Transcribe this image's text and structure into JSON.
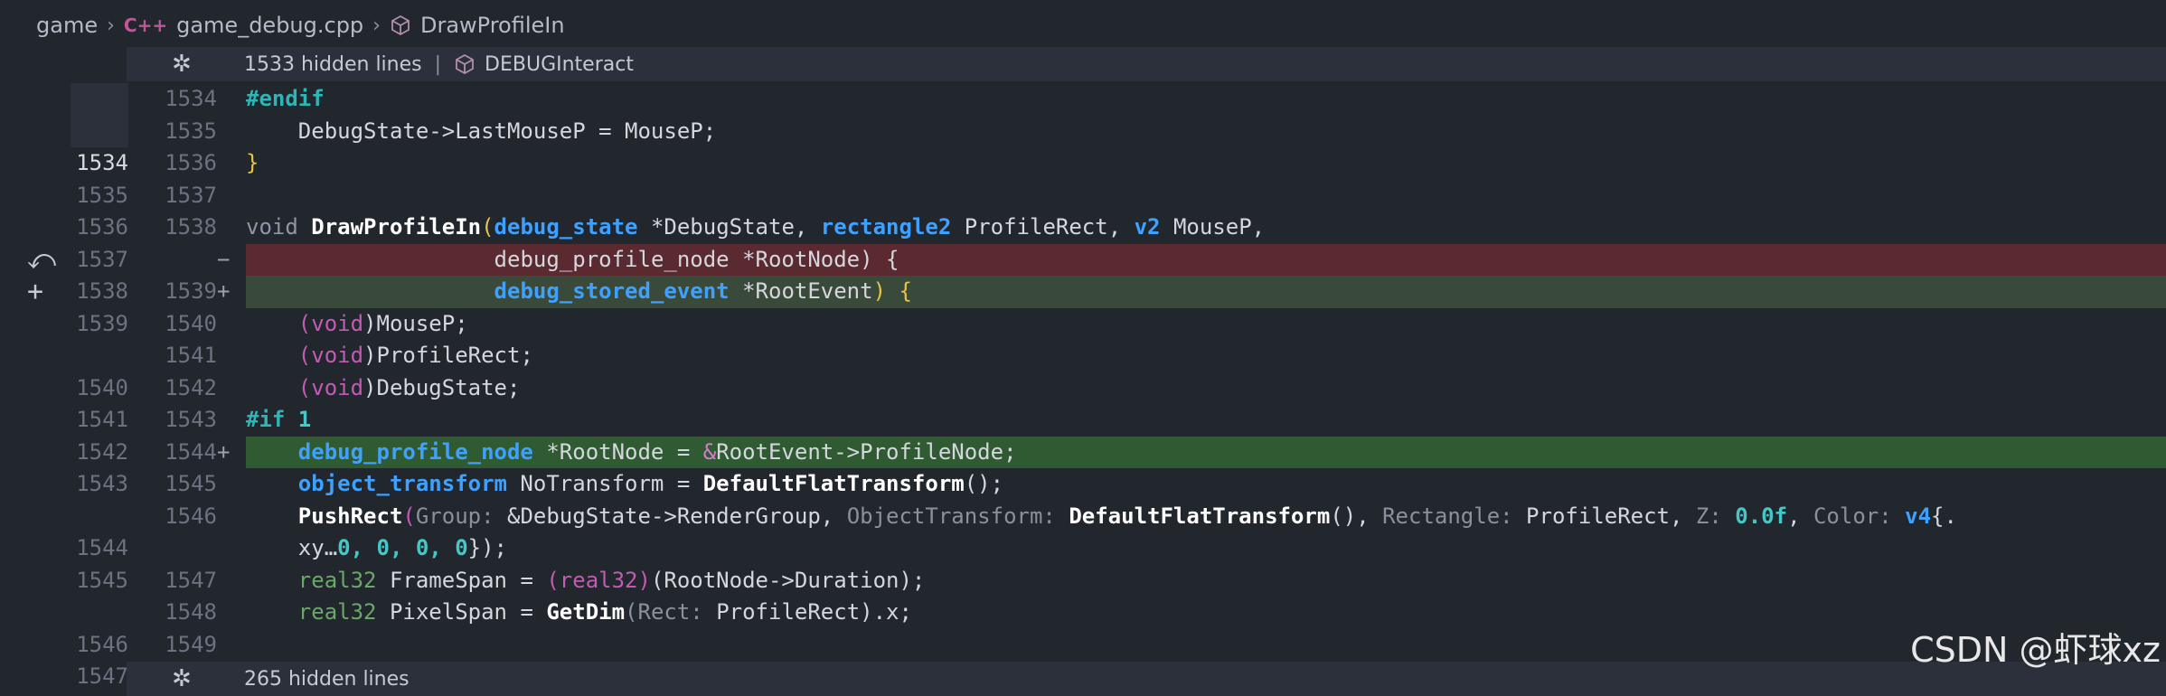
{
  "breadcrumb": {
    "folder": "game",
    "file": "game_debug.cpp",
    "file_icon": "C++",
    "symbol": "DrawProfileIn"
  },
  "fold_top": {
    "hidden": "1533 hidden lines",
    "symbol": "DEBUGInteract"
  },
  "fold_bottom": {
    "hidden": "265 hidden lines"
  },
  "gutter_icons": {
    "revert": "⤺",
    "add": "+"
  },
  "rows": [
    {
      "old": "",
      "new": "1534",
      "mark": ""
    },
    {
      "old": "",
      "new": "1535",
      "mark": ""
    },
    {
      "old": "1534",
      "new": "1536",
      "mark": ""
    },
    {
      "old": "1535",
      "new": "1537",
      "mark": ""
    },
    {
      "old": "1536",
      "new": "1538",
      "mark": ""
    },
    {
      "old": "1537",
      "new": "",
      "mark": "−"
    },
    {
      "old": "1538",
      "new": "1539",
      "mark": "+"
    },
    {
      "old": "1539",
      "new": "1540",
      "mark": ""
    },
    {
      "old": "",
      "new": "1541",
      "mark": ""
    },
    {
      "old": "1540",
      "new": "1542",
      "mark": ""
    },
    {
      "old": "1541",
      "new": "1543",
      "mark": ""
    },
    {
      "old": "1542",
      "new": "1544",
      "mark": "+"
    },
    {
      "old": "1543",
      "new": "1545",
      "mark": ""
    },
    {
      "old": "",
      "new": "1546",
      "mark": ""
    },
    {
      "old": "1544",
      "new": "",
      "mark": ""
    },
    {
      "old": "1545",
      "new": "1547",
      "mark": ""
    },
    {
      "old": "",
      "new": "1548",
      "mark": ""
    },
    {
      "old": "1546",
      "new": "1549",
      "mark": ""
    },
    {
      "old": "1547",
      "new": "",
      "mark": ""
    }
  ],
  "code": {
    "l0": "#endif",
    "l1a": "DebugState->LastMouseP = MouseP;",
    "l2": "}",
    "l4_void": "void ",
    "l4_fn": "DrawProfileIn",
    "l4_p": "(",
    "l4_t1": "debug_state",
    "l4_a1": " *DebugState, ",
    "l4_t2": "rectangle2",
    "l4_a2": " ProfileRect, ",
    "l4_t3": "v2",
    "l4_a3": " MouseP,",
    "l5": "debug_profile_node *RootNode) {",
    "l6_t": "debug_stored_event",
    "l6_a": " *RootEvent",
    "l6_p": ")",
    "l6_b": " {",
    "l7_a": "(",
    "l7_v": "void",
    "l7_b": ")MouseP;",
    "l8_b": ")ProfileRect;",
    "l9_b": ")DebugState;",
    "l10_a": "#if ",
    "l10_n": "1",
    "l11_t": "debug_profile_node",
    "l11_a": " *RootNode = ",
    "l11_op": "&",
    "l11_b": "RootEvent->ProfileNode;",
    "l12_t": "object_transform",
    "l12_a": " NoTransform = ",
    "l12_f": "DefaultFlatTransform",
    "l12_b": "();",
    "l13_f": "PushRect",
    "l13_a": "(",
    "l13_h1": "Group:",
    "l13_v1": " &DebugState->RenderGroup, ",
    "l13_h2": "ObjectTransform:",
    "l13_f2": " DefaultFlatTransform",
    "l13_v2": "(), ",
    "l13_h3": "Rectangle:",
    "l13_v3": " ProfileRect, ",
    "l13_h4": "Z:",
    "l13_n1": " 0.0f",
    "l13_v4": ", ",
    "l13_h5": "Color:",
    "l13_t5": " v4",
    "l13_v5": "{.",
    "l14_a": "xy…",
    "l14_n": "0, 0, 0, 0",
    "l14_b": "});",
    "l15_t": "real32",
    "l15_a": " FrameSpan = ",
    "l15_c": "(real32)",
    "l15_b": "(RootNode->Duration);",
    "l16_t": "real32",
    "l16_a": " PixelSpan = ",
    "l16_f": "GetDim",
    "l16_h": "(Rect:",
    "l16_b": " ProfileRect).x;"
  },
  "watermark": "CSDN @虾球xz",
  "colors": {
    "background": "#22262d",
    "deleted_line": "#5a2a30",
    "added_line": "#2f5a32",
    "keyword": "#3ea1ff",
    "type_green": "#6aa86a"
  }
}
